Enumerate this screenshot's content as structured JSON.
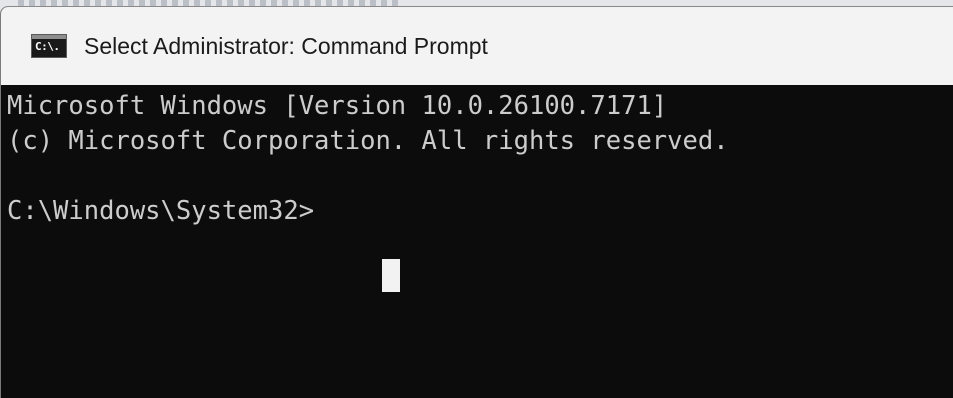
{
  "window": {
    "title": "Select Administrator: Command Prompt",
    "icon": "cmd-console-icon",
    "icon_text": "C:\\."
  },
  "console": {
    "lines": [
      "Microsoft Windows [Version 10.0.26100.7171]",
      "(c) Microsoft Corporation. All rights reserved.",
      "",
      "C:\\Windows\\System32>"
    ]
  },
  "colors": {
    "console_background": "#0c0c0c",
    "console_text": "#cccccc",
    "titlebar_background": "#f3f3f3",
    "cursor": "#f2f2f2"
  }
}
